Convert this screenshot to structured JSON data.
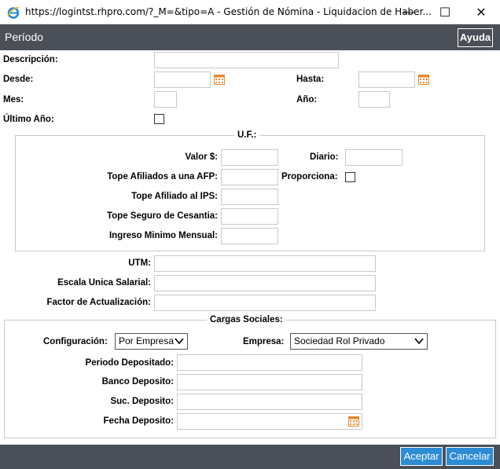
{
  "window": {
    "title": "https://logintst.rhpro.com/?_M=&tipo=A - Gestión de Nómina - Liquidacion de Haber...",
    "min_glyph": "—",
    "max_glyph": "☐",
    "close_glyph": "✕"
  },
  "header": {
    "title": "Período",
    "help_label": "Ayuda"
  },
  "periodo": {
    "descripcion_label": "Descripción:",
    "desde_label": "Desde:",
    "hasta_label": "Hasta:",
    "mes_label": "Mes:",
    "anio_label": "Año:",
    "ultimo_anio_label": "Último Año:"
  },
  "uf": {
    "legend": "U.F.:",
    "valor_label": "Valor $:",
    "diario_label": "Diario:",
    "tope_afp_label": "Tope Afiliados a una AFP:",
    "proporciona_label": "Proporciona:",
    "tope_ips_label": "Tope Afiliado al IPS:",
    "tope_cesantia_label": "Tope Seguro de Cesantia:",
    "ingreso_minimo_label": "Ingreso Minimo Mensual:"
  },
  "misc": {
    "utm_label": "UTM:",
    "escala_label": "Escala Unica Salarial:",
    "factor_label": "Factor de Actualización:"
  },
  "cargas": {
    "legend": "Cargas Sociales:",
    "configuracion_label": "Configuración:",
    "configuracion_value": "Por Empresa",
    "empresa_label": "Empresa:",
    "empresa_value": "Sociedad Rol Privado",
    "periodo_depositado_label": "Periodo Depositado:",
    "banco_label": "Banco Deposito:",
    "suc_label": "Suc. Deposito:",
    "fecha_label": "Fecha Deposito:"
  },
  "footer": {
    "accept_label": "Aceptar",
    "cancel_label": "Cancelar"
  },
  "colors": {
    "header_bg": "#4b4f57",
    "button_blue": "#2c8cd4",
    "calendar_orange": "#e8872a"
  }
}
